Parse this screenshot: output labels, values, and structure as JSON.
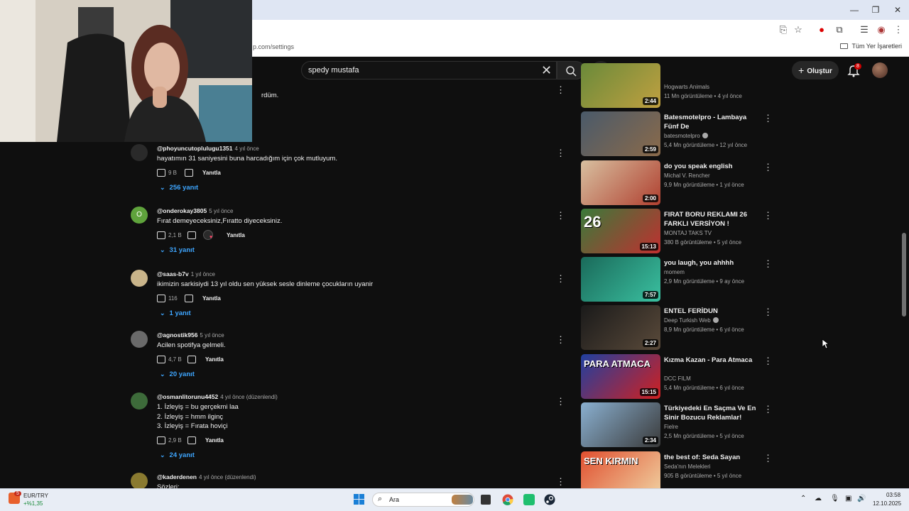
{
  "browser": {
    "url_fragment": "p.com/settings",
    "bookmarks_folder": "Tüm Yer İşaretleri",
    "window_controls": [
      "minimize-icon",
      "restore-icon",
      "close-icon"
    ]
  },
  "youtube": {
    "search_value": "spedy mustafa",
    "create_label": "Oluştur",
    "notifications_count": "8"
  },
  "comments": {
    "partial_first": "rdüm.",
    "items": [
      {
        "author": "@phoyuncutoplulugu1351",
        "time": "4 yıl önce",
        "text": [
          "hayatımın 31 saniyesini buna harcadığım için çok mutluyum."
        ],
        "likes": "9 B",
        "reply": "Yanıtla",
        "replies": "256 yanıt",
        "avatar_color": "#2a2a2a"
      },
      {
        "author": "@onderokay3805",
        "time": "5 yıl önce",
        "text": [
          "Fırat demeyeceksiniz,Fıratto diyeceksiniz."
        ],
        "likes": "2,1 B",
        "reply": "Yanıtla",
        "replies": "31 yanıt",
        "avatar_color": "#5fa33c",
        "initial": "O"
      },
      {
        "author": "@saas-b7v",
        "time": "1 yıl önce",
        "text": [
          "ikimizin sarkisiydi 13 yıl oldu sen yüksek sesle dinleme çocukların uyanir"
        ],
        "likes": "116",
        "reply": "Yanıtla",
        "replies": "1 yanıt",
        "avatar_color": "#c9b48a"
      },
      {
        "author": "@agnostik956",
        "time": "5 yıl önce",
        "text": [
          "Acilen spotifya gelmeli."
        ],
        "likes": "4,7 B",
        "reply": "Yanıtla",
        "replies": "20 yanıt",
        "avatar_color": "#6a6a6a"
      },
      {
        "author": "@osmanlitorunu4452",
        "time": "4 yıl önce (düzenlendi)",
        "text": [
          "1. İzleyiş =  bu gerçekmi laa",
          "2.  İzleyiş = hmm ilginç",
          "3. İzleyiş = Fırata hoviçi"
        ],
        "likes": "2,9 B",
        "reply": "Yanıtla",
        "replies": "24 yanıt",
        "avatar_color": "#3d6b3a"
      },
      {
        "author": "@kaderdenen",
        "time": "4 yıl önce (düzenlendi)",
        "text": [
          "Sözleri:"
        ],
        "avatar_color": "#8a7a30"
      }
    ]
  },
  "sidebar": {
    "videos": [
      {
        "title": "",
        "channel": "Hogwarts Animals",
        "meta": "11 Mn görüntüleme • 4 yıl önce",
        "duration": "2:44",
        "colors": [
          "#6a8a3a",
          "#c0a040"
        ]
      },
      {
        "title": "Batesmotelpro - Lambaya Fünf De",
        "channel": "batesmotelpro",
        "verified": true,
        "meta": "5,4 Mn görüntüleme • 12 yıl önce",
        "duration": "2:59",
        "colors": [
          "#4a5a6a",
          "#8a6a4a"
        ]
      },
      {
        "title": "do you speak english",
        "channel": "Michal V. Rencher",
        "meta": "9,9 Mn görüntüleme • 1 yıl önce",
        "duration": "2:00",
        "colors": [
          "#d8c0a0",
          "#b04030"
        ]
      },
      {
        "title": "FIRAT BORU REKLAMI 26 FARKLI VERSİYON !",
        "channel": "MONTAJ TAKS TV",
        "meta": "380 B görüntüleme • 5 yıl önce",
        "duration": "15:13",
        "colors": [
          "#3a7a3a",
          "#c03030"
        ],
        "overlay": "26"
      },
      {
        "title": "you laugh, you ahhhh",
        "channel": "momem",
        "meta": "2,9 Mn görüntüleme • 9 ay önce",
        "duration": "7:57",
        "colors": [
          "#1a6a5a",
          "#3ac0a0"
        ]
      },
      {
        "title": "ENTEL FERİDUN",
        "channel": "Deep Turkish Web",
        "verified": true,
        "meta": "8,9 Mn görüntüleme • 6 yıl önce",
        "duration": "2:27",
        "colors": [
          "#1a1a1a",
          "#5a4a3a"
        ]
      },
      {
        "title": "Kızma Kazan - Para Atmaca",
        "channel": "DCC FILM",
        "meta": "5,4 Mn görüntüleme • 6 yıl önce",
        "duration": "15:15",
        "colors": [
          "#2040a0",
          "#d02020"
        ],
        "overlay": "PARA ATMACA"
      },
      {
        "title": "Türkiyedeki En Saçma Ve En Sinir Bozucu Reklamlar!",
        "channel": "Fielre",
        "meta": "2,5 Mn görüntüleme • 5 yıl önce",
        "duration": "2:34",
        "colors": [
          "#8ab0d0",
          "#3a3a3a"
        ]
      },
      {
        "title": "the best of: Seda Sayan",
        "channel": "Seda'nın Melekleri",
        "meta": "905 B görüntüleme • 5 yıl önce",
        "duration": "",
        "colors": [
          "#e05030",
          "#f0d0a0"
        ],
        "overlay": "SEN KIRMIN"
      }
    ]
  },
  "taskbar": {
    "widget_badge": "5",
    "currency": "EUR/TRY",
    "change": "+%1,35",
    "search_label": "Ara",
    "time": "03:58",
    "date": "12.10.2025"
  }
}
